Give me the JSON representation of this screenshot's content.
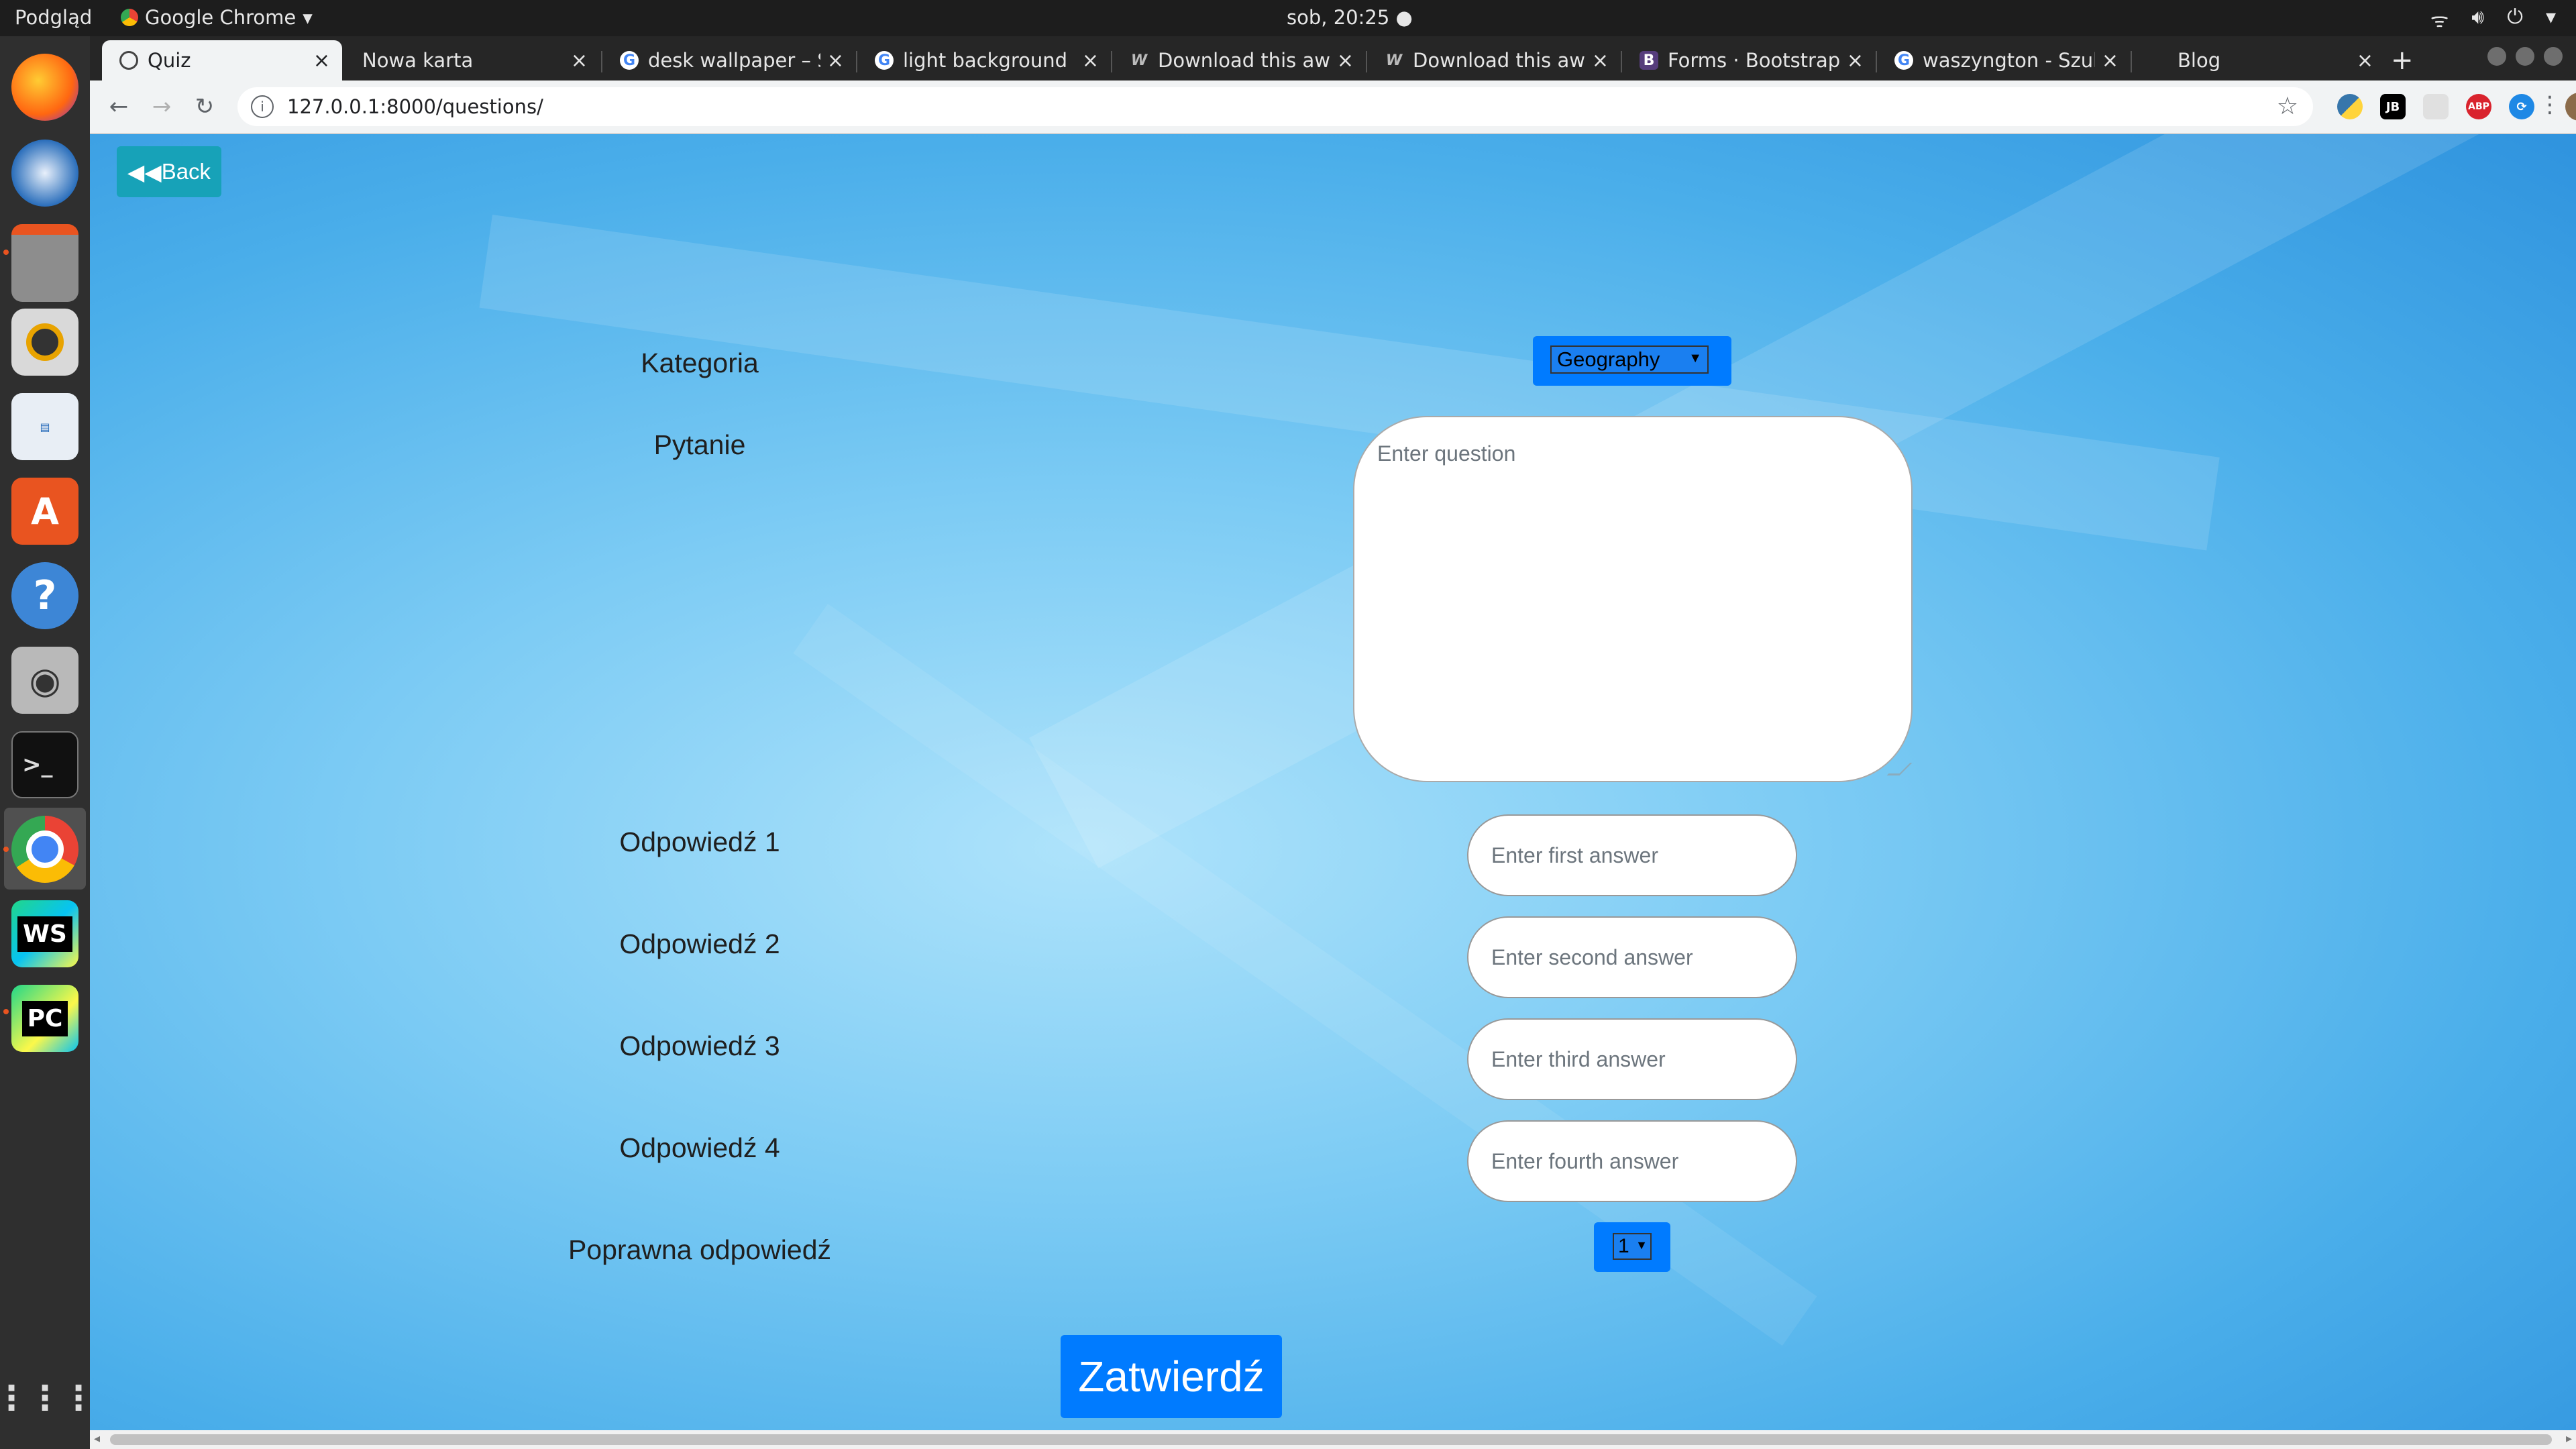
{
  "os": {
    "app_menu": "Podgląd",
    "active_app": "Google Chrome",
    "clock": "sob, 20:25 ●"
  },
  "dock": [
    "firefox-icon",
    "thunderbird-icon",
    "files-icon",
    "rhythmbox-icon",
    "libreoffice-impress-icon",
    "ubuntu-software-icon",
    "help-icon",
    "camera-icon",
    "terminal-icon",
    "chrome-icon",
    "webstorm-icon",
    "pycharm-icon",
    "show-apps-icon"
  ],
  "browser": {
    "tabs": [
      {
        "title": "Quiz",
        "favicon": "globe-icon"
      },
      {
        "title": "Nowa karta",
        "favicon": ""
      },
      {
        "title": "desk wallpaper – S",
        "favicon": "google-icon"
      },
      {
        "title": "light background",
        "favicon": "google-icon"
      },
      {
        "title": "Download this aw",
        "favicon": "wallhaven-icon"
      },
      {
        "title": "Download this aw",
        "favicon": "wallhaven-icon"
      },
      {
        "title": "Forms · Bootstrap",
        "favicon": "bootstrap-icon"
      },
      {
        "title": "waszyngton - Szuk",
        "favicon": "google-icon"
      },
      {
        "title": "Blog",
        "favicon": ""
      }
    ],
    "new_tab": "+",
    "url": "127.0.0.1:8000/questions/"
  },
  "form": {
    "back_label": "Back",
    "category_label": "Kategoria",
    "category_value": "Geography",
    "question_label": "Pytanie",
    "question_placeholder": "Enter question",
    "answers": [
      {
        "label": "Odpowiedź 1",
        "placeholder": "Enter first answer"
      },
      {
        "label": "Odpowiedź 2",
        "placeholder": "Enter second answer"
      },
      {
        "label": "Odpowiedź 3",
        "placeholder": "Enter third answer"
      },
      {
        "label": "Odpowiedź 4",
        "placeholder": "Enter fourth answer"
      }
    ],
    "correct_label": "Poprawna odpowiedź",
    "correct_value": "1",
    "submit_label": "Zatwierdź"
  },
  "colors": {
    "primary": "#007bff",
    "info": "#17a2b8"
  }
}
